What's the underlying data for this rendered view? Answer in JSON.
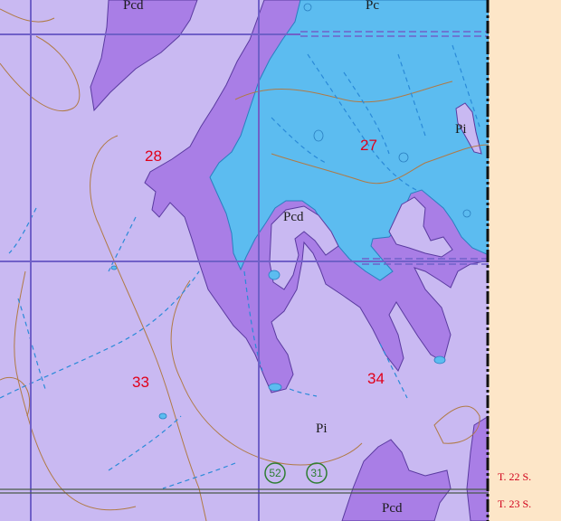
{
  "map": {
    "colors": {
      "plains_unit": "#c9b9f2",
      "canyon_unit": "#a97ee6",
      "water_area": "#5cbcf0",
      "margin": "#fde6c8",
      "contour": "#b07a45",
      "section_line": "#7060c8",
      "section_number": "#e0001a",
      "stream": "#2a8ad8",
      "route_marker": "#2e7d32"
    },
    "section_numbers": [
      "28",
      "27",
      "33",
      "34"
    ],
    "geologic_units": [
      "Pc",
      "Pcd",
      "Pi",
      "Pcd",
      "Pi",
      "Pcd",
      "Pi"
    ],
    "township_labels": [
      "T. 22 S.",
      "T. 23 S."
    ],
    "route_markers": [
      "52",
      "31"
    ]
  }
}
